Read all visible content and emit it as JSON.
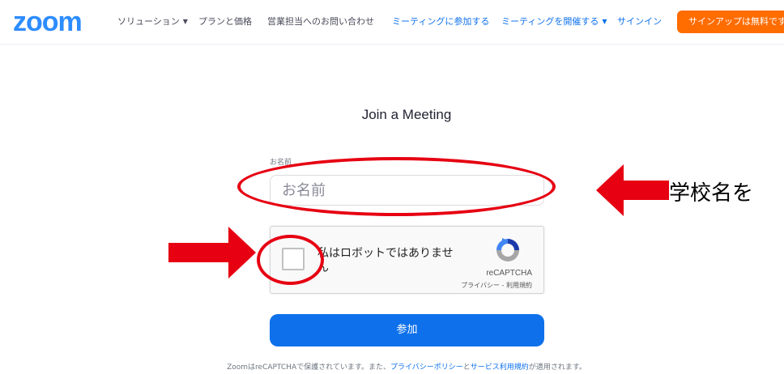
{
  "header": {
    "logo": "zoom",
    "nav": [
      {
        "label": "ソリューション",
        "dropdown": true
      },
      {
        "label": "プランと価格",
        "dropdown": false
      },
      {
        "label": "営業担当へのお問い合わせ",
        "dropdown": false
      },
      {
        "label": "ミーティングに参加する",
        "dropdown": false
      },
      {
        "label": "ミーティングを開催する",
        "dropdown": true
      },
      {
        "label": "サインイン",
        "dropdown": false
      }
    ],
    "signup": "サインアップは無料です"
  },
  "main": {
    "title": "Join a Meeting",
    "name_label": "お名前",
    "name_placeholder": "お名前",
    "name_value": "",
    "captcha": {
      "text": "私はロボットではありません",
      "brand": "reCAPTCHA",
      "privacy": "プライバシー",
      "separator": " - ",
      "terms": "利用規約"
    },
    "join_button": "参加",
    "footnote": {
      "prefix": "ZoomはreCAPTCHAで保護されています。また、",
      "privacy_link": "プライバシーポリシー",
      "and": "と",
      "terms_link": "サービス利用規約",
      "suffix": "が適用されます。"
    }
  },
  "annotations": {
    "arrow_text": "学校名を",
    "color": "#e60012"
  },
  "colors": {
    "brand_blue": "#2D8CFF",
    "link_blue": "#0E71EB",
    "signup_orange": "#FF6C00",
    "annotation_red": "#e60012"
  }
}
